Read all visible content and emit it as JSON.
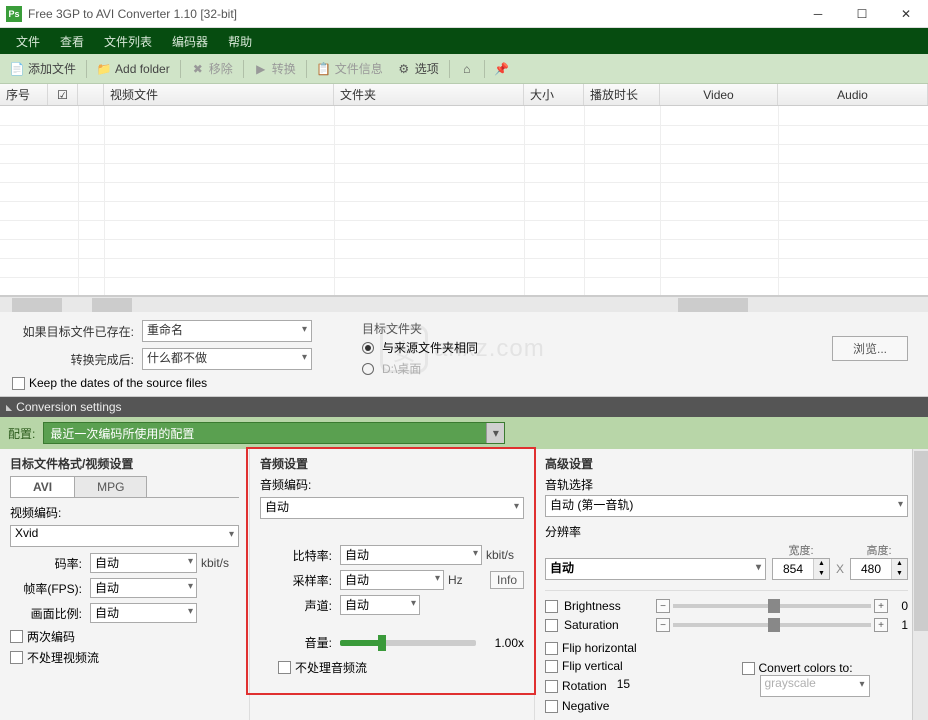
{
  "window": {
    "title": "Free 3GP to AVI Converter 1.10   [32-bit]"
  },
  "menu": {
    "file": "文件",
    "view": "查看",
    "filelist": "文件列表",
    "encoder": "编码器",
    "help": "帮助"
  },
  "toolbar": {
    "add_files": "添加文件",
    "add_folder": "Add folder",
    "remove": "移除",
    "convert": "转换",
    "file_info": "文件信息",
    "options": "选项"
  },
  "table": {
    "col_num": "序号",
    "col_video": "视频文件",
    "col_folder": "文件夹",
    "col_size": "大小",
    "col_duration": "播放时长",
    "col_vcodec": "Video",
    "col_acodec": "Audio"
  },
  "mid": {
    "if_exists_label": "如果目标文件已存在:",
    "if_exists_value": "重命名",
    "after_convert_label": "转换完成后:",
    "after_convert_value": "什么都不做",
    "keep_dates": "Keep the dates of the source files",
    "dest_folder_label": "目标文件夹",
    "same_as_src": "与来源文件夹相同",
    "desktop_path": "D:\\桌面",
    "browse": "浏览..."
  },
  "conv_header": "Conversion settings",
  "config": {
    "label": "配置:",
    "value": "最近一次编码所使用的配置"
  },
  "left": {
    "title": "目标文件格式/视频设置",
    "tab_avi": "AVI",
    "tab_mpg": "MPG",
    "video_encoding_label": "视频编码:",
    "video_encoding_value": "Xvid",
    "bitrate_label": "码率:",
    "bitrate_value": "自动",
    "bitrate_unit": "kbit/s",
    "fps_label": "帧率(FPS):",
    "fps_value": "自动",
    "aspect_label": "画面比例:",
    "aspect_value": "自动",
    "two_pass": "两次编码",
    "no_video": "不处理视频流"
  },
  "audio": {
    "title": "音频设置",
    "encoding_label": "音频编码:",
    "encoding_value": "自动",
    "bitrate_label": "比特率:",
    "bitrate_value": "自动",
    "bitrate_unit": "kbit/s",
    "sample_label": "采样率:",
    "sample_value": "自动",
    "sample_unit": "Hz",
    "info_btn": "Info",
    "channel_label": "声道:",
    "channel_value": "自动",
    "volume_label": "音量:",
    "volume_value": "1.00x",
    "no_audio": "不处理音频流"
  },
  "adv": {
    "title": "高级设置",
    "track_label": "音轨选择",
    "track_value": "自动 (第一音轨)",
    "res_label": "分辨率",
    "res_value": "自动",
    "width_label": "宽度:",
    "width_value": "854",
    "height_label": "高度:",
    "height_value": "480",
    "x": "X",
    "brightness": "Brightness",
    "brightness_val": "0",
    "saturation": "Saturation",
    "saturation_val": "1",
    "flip_h": "Flip horizontal",
    "flip_v": "Flip vertical",
    "rotation": "Rotation",
    "rotation_val": "15",
    "convert_colors": "Convert colors to:",
    "grayscale": "grayscale",
    "negative": "Negative"
  }
}
